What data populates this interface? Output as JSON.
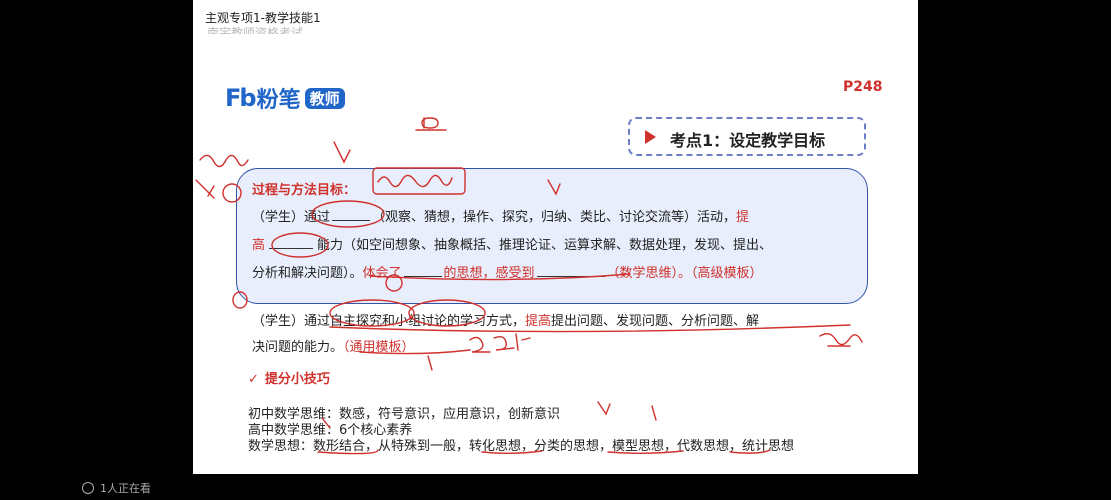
{
  "window": {
    "title": "主观专项1-教学技能1",
    "subtitle": "南宇教师资格考试"
  },
  "slide": {
    "brand": "粉笔",
    "brand_badge": "教师",
    "page": "P248",
    "keypoint": "考点1：设定教学目标",
    "goal_label": "过程与方法目标：",
    "goal_line1_a": "（学生）通过",
    "goal_line1_b": "（观察、猜想，操作、探究，归纳、类比、讨论交流等）活动，",
    "goal_line1_c": "提",
    "goal_line2_a": "高",
    "goal_line2_b": "能力（如空间想象、抽象概括、推理论证、运算求解、数据处理，发现、提出、",
    "goal_line3_a": "分析和解决问题）。",
    "goal_line3_b": "体会了",
    "goal_line3_c": "的思想，感受到",
    "goal_line3_d": "（数学思维）。（高级模板）",
    "general_line1_a": "（学生）通过自主探究和小组讨论的学习方式，",
    "general_line1_b": "提高",
    "general_line1_c": "提出问题、发现问题、分析问题、解",
    "general_line2_a": "决问题的能力。",
    "general_line2_b": "（通用模板）",
    "tips_check": "✓",
    "tips_title": "提分小技巧",
    "line_junior": "初中数学思维：数感，符号意识，应用意识，创新意识",
    "line_senior": "高中数学思维：6个核心素养",
    "line_ideas": "数学思想：数形结合，从特殊到一般，转化思想，分类的思想，模型思想，代数思想，统计思想"
  },
  "footer": {
    "viewers": "1人正在看"
  },
  "colors": {
    "brand": "#1f66c8",
    "accent": "#d0312d",
    "panel": "#e8eefb"
  }
}
